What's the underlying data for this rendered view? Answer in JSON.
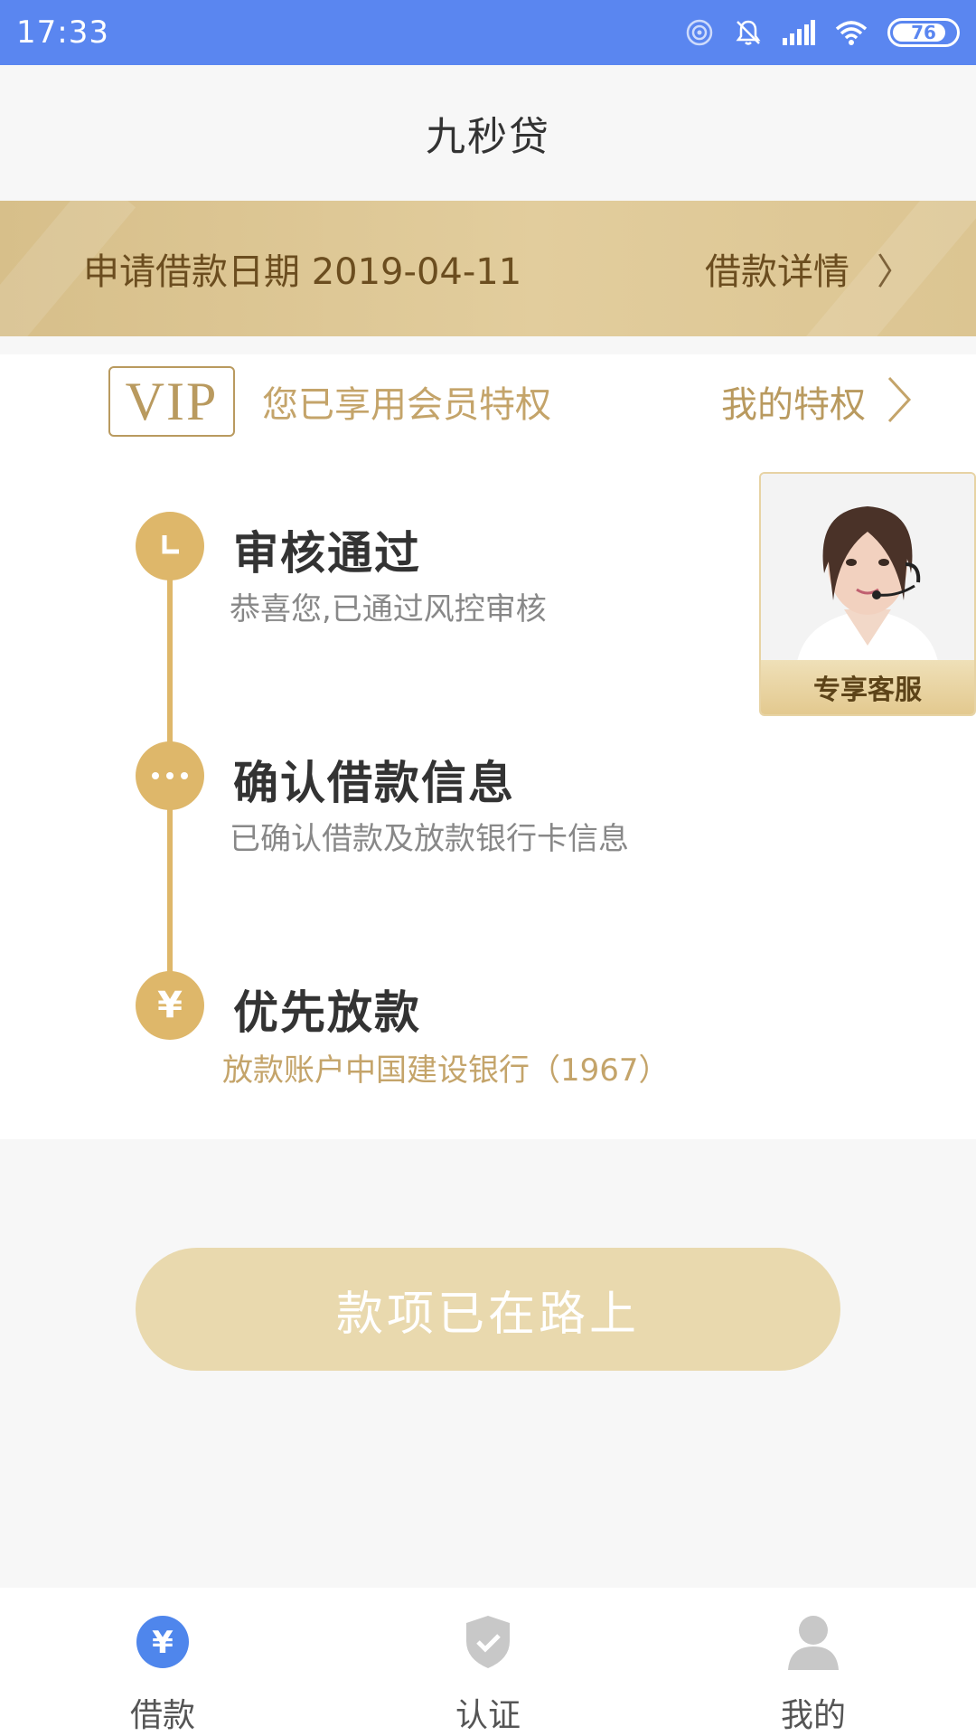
{
  "status_bar": {
    "time": "17:33",
    "battery": "76",
    "icons": [
      "hotspot-icon",
      "bell-muted-icon",
      "signal-icon",
      "wifi-icon",
      "battery-icon"
    ]
  },
  "header": {
    "title": "九秒贷"
  },
  "banner": {
    "date_text": "申请借款日期 2019-04-11",
    "link_label": "借款详情",
    "chevron": "〉"
  },
  "vip": {
    "badge": "VIP",
    "text": "您已享用会员特权",
    "link_label": "我的特权"
  },
  "steps": [
    {
      "icon": "clock-icon",
      "title": "审核通过",
      "desc": "恭喜您,已通过风控审核"
    },
    {
      "icon": "more-dots-icon",
      "title": "确认借款信息",
      "desc": "已确认借款及放款银行卡信息"
    },
    {
      "icon": "yuan-icon",
      "title": "优先放款",
      "desc": "放款账户中国建设银行（1967）"
    }
  ],
  "service": {
    "label": "专享客服"
  },
  "main_button": {
    "label": "款项已在路上"
  },
  "bottom_nav": [
    {
      "label": "借款",
      "icon": "yuan-circle-icon",
      "active": true
    },
    {
      "label": "认证",
      "icon": "shield-check-icon",
      "active": false
    },
    {
      "label": "我的",
      "icon": "person-icon",
      "active": false
    }
  ],
  "colors": {
    "status_bar": "#5a86f0",
    "gold": "#deb76a",
    "gold_text": "#c4a46a",
    "button": "#e9d9ae"
  }
}
